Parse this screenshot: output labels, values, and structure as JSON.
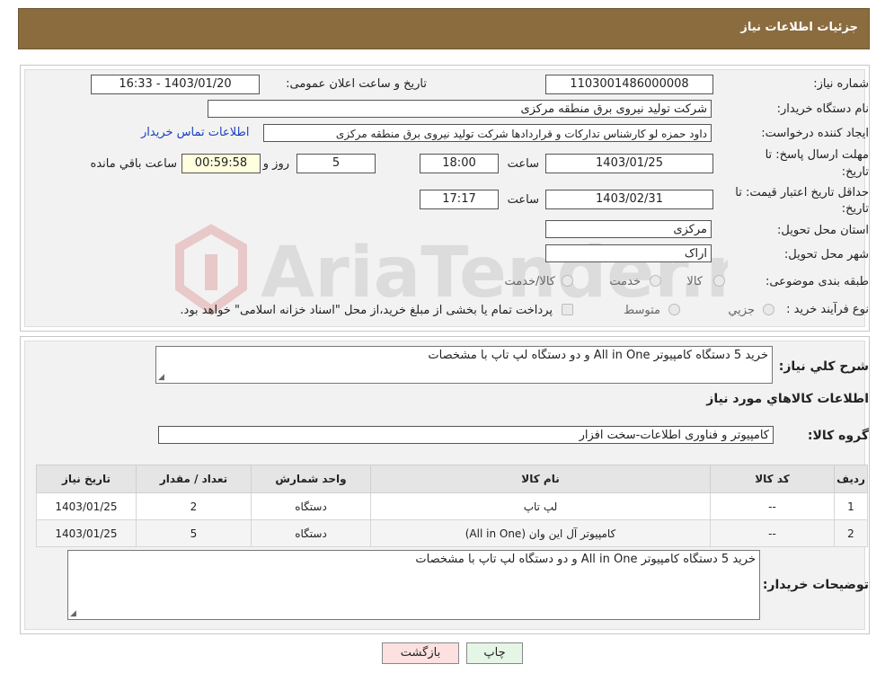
{
  "header": {
    "title": "جزئیات اطلاعات نیاز"
  },
  "form": {
    "need_number_label": "شماره نیاز:",
    "need_number": "1103001486000008",
    "announce_label": "تاریخ و ساعت اعلان عمومی:",
    "announce_value": "1403/01/20 - 16:33",
    "buyer_org_label": "نام دستگاه خریدار:",
    "buyer_org": "شرکت تولید نیروی برق منطقه مرکزی",
    "creator_label": "ایجاد کننده درخواست:",
    "creator": "داود حمزه لو کارشناس تدارکات و قراردادها شرکت تولید نیروی برق منطقه مرکزی",
    "contact_link": "اطلاعات تماس خریدار",
    "deadline_label_1": "مهلت ارسال پاسخ: تا",
    "deadline_label_2": "تاریخ:",
    "deadline_date": "1403/01/25",
    "time_label": "ساعت",
    "deadline_time": "18:00",
    "days_value": "5",
    "days_label": "روز و",
    "remaining_time": "00:59:58",
    "remaining_label": "ساعت باقي مانده",
    "validity_label_1": "حداقل تاریخ اعتبار قیمت: تا",
    "validity_label_2": "تاریخ:",
    "validity_date": "1403/02/31",
    "validity_time": "17:17",
    "province_label": "استان محل تحویل:",
    "province": "مرکزی",
    "city_label": "شهر محل تحویل:",
    "city": "اراک",
    "category_label": "طبقه بندی موضوعی:",
    "category_options": [
      "کالا",
      "خدمت",
      "کالا/خدمت"
    ],
    "process_label": "نوع فرآیند خرید :",
    "process_options": [
      "جزیي",
      "متوسط"
    ],
    "process_note": "پرداخت تمام یا بخشی از مبلغ خرید،از محل \"اسناد خزانه اسلامی\" خواهد بود."
  },
  "watermark": {
    "text": "AriaTender.neT"
  },
  "details": {
    "summary_label": "شرح کلي نیاز:",
    "summary": "خرید 5 دستگاه کامپیوتر All in One  و دو دستگاه لپ تاپ با مشخصات",
    "goods_info_title": "اطلاعات کالاهاي مورد نیاز",
    "goods_group_label": "گروه کالا:",
    "goods_group": "کامپیوتر و فناوری اطلاعات-سخت افزار",
    "table": {
      "headers": [
        "ردیف",
        "کد کالا",
        "نام کالا",
        "واحد شمارش",
        "تعداد / مقدار",
        "تاریخ نیاز"
      ],
      "rows": [
        [
          "1",
          "--",
          "لپ تاپ",
          "دستگاه",
          "2",
          "1403/01/25"
        ],
        [
          "2",
          "--",
          "کامپیوتر آل این وان (All in One)",
          "دستگاه",
          "5",
          "1403/01/25"
        ]
      ]
    },
    "buyer_notes_label": "توضیحات خریدار:",
    "buyer_notes": "خرید 5 دستگاه کامپیوتر All in One  و دو دستگاه لپ تاپ با مشخصات"
  },
  "buttons": {
    "print": "چاپ",
    "back": "بازگشت"
  },
  "colors": {
    "header_bg": "#8b6c3f",
    "link": "#1a3fc2",
    "back_btn": "#fde0e0",
    "print_btn": "#e6f6e6"
  }
}
